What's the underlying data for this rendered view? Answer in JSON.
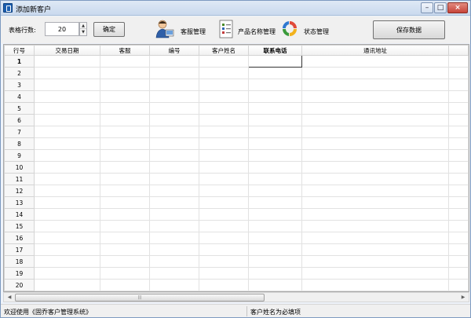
{
  "window": {
    "title": "添加新客户",
    "minimize": "–",
    "maximize": "□",
    "close": "×"
  },
  "toolbar": {
    "rows_label": "表格行数:",
    "rows_value": "20",
    "confirm": "确定",
    "staff_mgmt": "客服管理",
    "product_mgmt": "产品名称管理",
    "status_mgmt": "状态管理",
    "save": "保存数据",
    "icons": [
      "staff-icon",
      "product-list-icon",
      "status-cycle-icon"
    ]
  },
  "grid": {
    "columns": [
      "行号",
      "交易日期",
      "客服",
      "编号",
      "客户姓名",
      "联系电话",
      "通讯地址"
    ],
    "selected_column": "联系电话",
    "current_row": "1",
    "rows": [
      "1",
      "2",
      "3",
      "4",
      "5",
      "6",
      "7",
      "8",
      "9",
      "10",
      "11",
      "12",
      "13",
      "14",
      "15",
      "16",
      "17",
      "18",
      "19",
      "20"
    ]
  },
  "status": {
    "left": "欢迎使用《固乔客户管理系统》",
    "right": "客户姓名为必填项"
  }
}
